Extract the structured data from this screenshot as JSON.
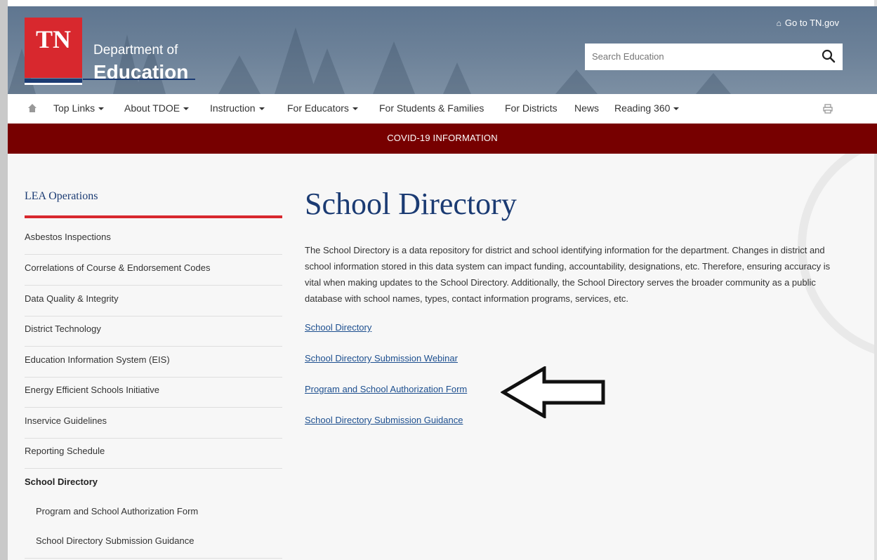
{
  "header": {
    "logo_text": "TN",
    "dept_line1": "Department of",
    "dept_line2": "Education",
    "go_tn_label": "Go to TN.gov",
    "search": {
      "placeholder": "Search Education",
      "value": ""
    }
  },
  "nav": {
    "items": [
      {
        "label": "Top Links",
        "dropdown": true
      },
      {
        "label": "About TDOE",
        "dropdown": true
      },
      {
        "label": "Instruction",
        "dropdown": true
      },
      {
        "label": "For Educators",
        "dropdown": true
      },
      {
        "label": "For Students & Families",
        "dropdown": false
      },
      {
        "label": "For Districts",
        "dropdown": false
      },
      {
        "label": "News",
        "dropdown": false
      },
      {
        "label": "Reading 360",
        "dropdown": true
      }
    ]
  },
  "banner": {
    "text": "COVID-19 INFORMATION"
  },
  "sidebar": {
    "title": "LEA Operations",
    "items": [
      {
        "label": "Asbestos Inspections"
      },
      {
        "label": "Correlations of Course & Endorsement Codes"
      },
      {
        "label": "Data Quality & Integrity"
      },
      {
        "label": "District Technology"
      },
      {
        "label": "Education Information System (EIS)"
      },
      {
        "label": "Energy Efficient Schools Initiative"
      },
      {
        "label": "Inservice Guidelines"
      },
      {
        "label": "Reporting Schedule"
      },
      {
        "label": "School Directory"
      },
      {
        "label": "Program and School Authorization Form"
      },
      {
        "label": "School Directory Submission Guidance"
      }
    ]
  },
  "main": {
    "title": "School Directory",
    "intro": "The School Directory is a data repository for district and school identifying information for the department. Changes in district and school information stored in this data system can impact funding, accountability, designations, etc. Therefore, ensuring accuracy is vital when making updates to the School Directory. Additionally, the School Directory serves the broader community as a public database with school names, types, contact information programs, services, etc.",
    "links": [
      {
        "label": "School Directory"
      },
      {
        "label": "School Directory Submission Webinar"
      },
      {
        "label": "Program and School Authorization Form"
      },
      {
        "label": "School Directory Submission Guidance"
      }
    ]
  },
  "colors": {
    "brand_red": "#d8282e",
    "brand_navy": "#1b3b73",
    "banner_maroon": "#770000",
    "link_blue": "#1d4f8f"
  },
  "icons": [
    "home-icon",
    "search-icon",
    "print-icon",
    "arrow-left-annotation"
  ]
}
